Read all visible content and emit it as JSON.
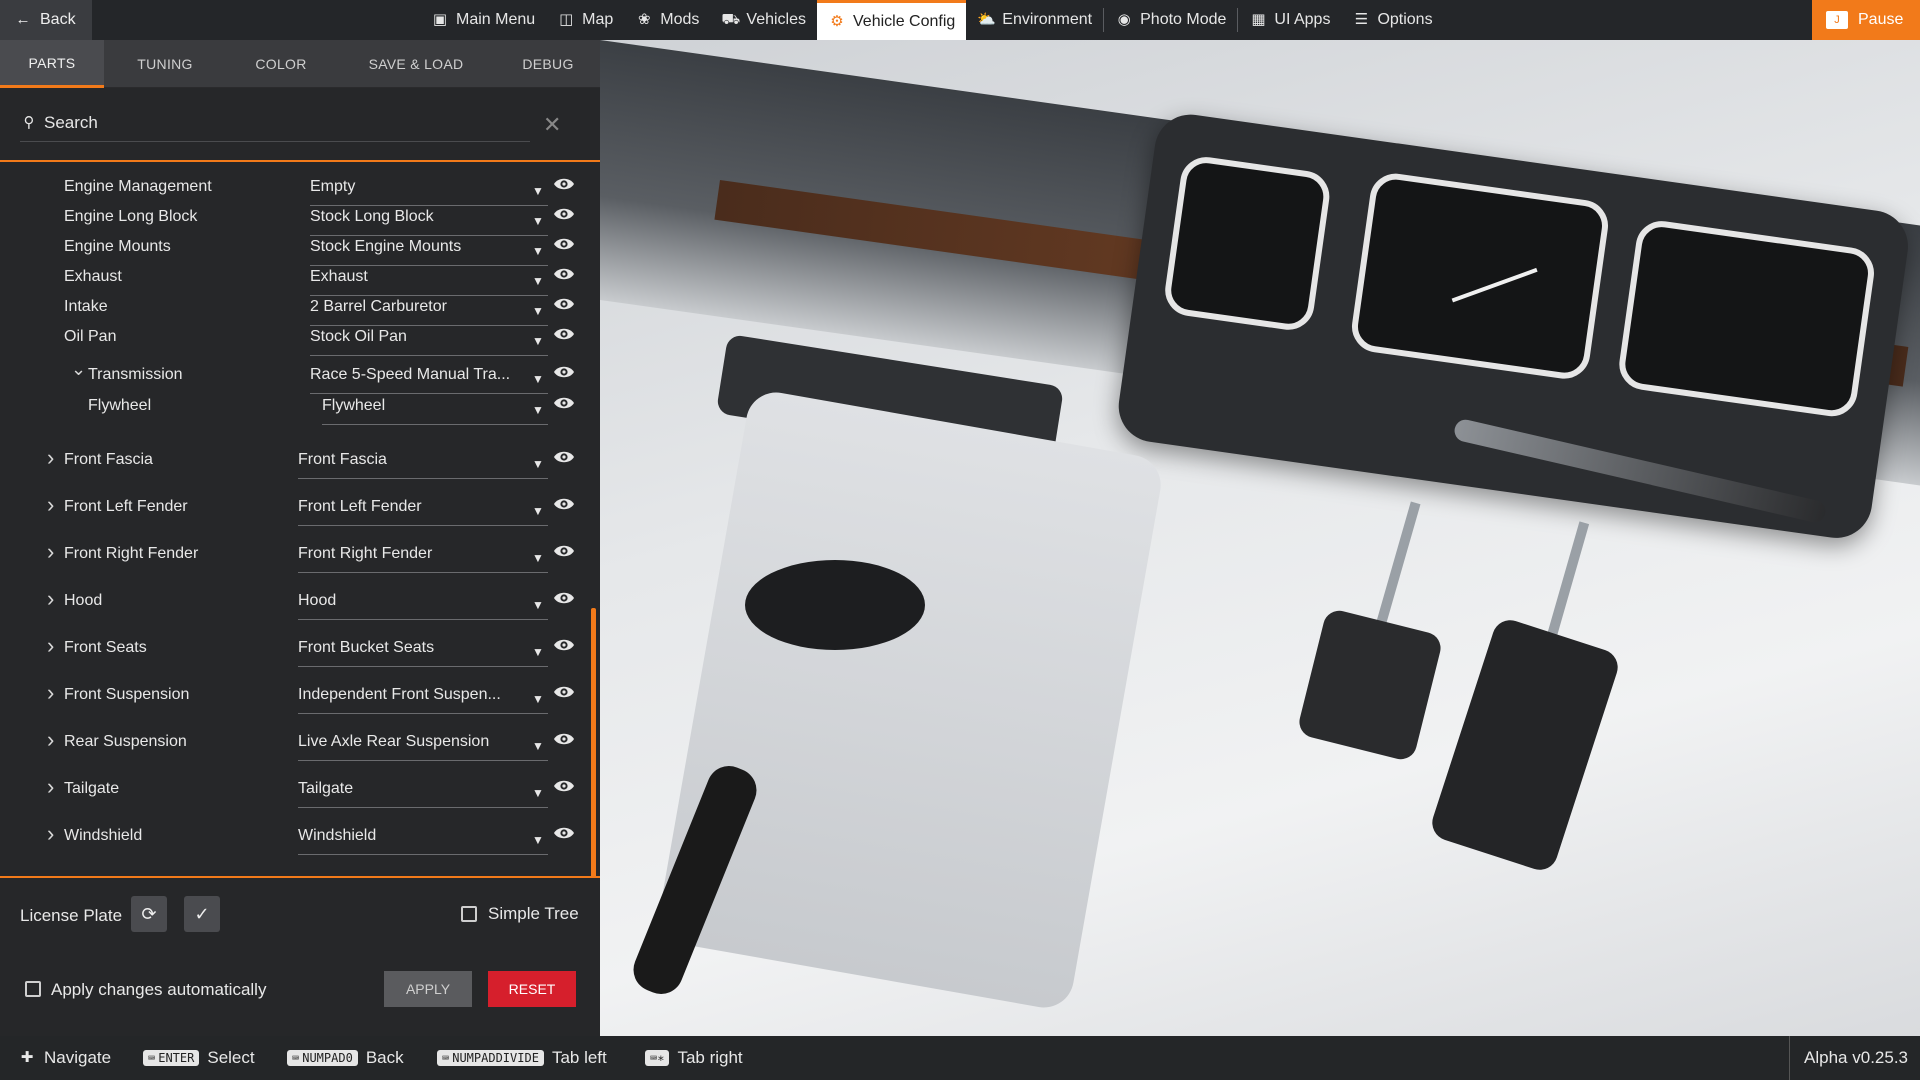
{
  "topbar": {
    "back_label": "Back",
    "nav": [
      {
        "label": "Main Menu",
        "icon": "home-icon"
      },
      {
        "label": "Map",
        "icon": "map-icon"
      },
      {
        "label": "Mods",
        "icon": "puzzle-icon"
      },
      {
        "label": "Vehicles",
        "icon": "car-icon"
      },
      {
        "label": "Vehicle Config",
        "icon": "engine-icon",
        "active": true
      },
      {
        "label": "Environment",
        "icon": "weather-icon"
      },
      {
        "label": "Photo Mode",
        "icon": "camera-icon"
      },
      {
        "label": "UI Apps",
        "icon": "apps-icon"
      },
      {
        "label": "Options",
        "icon": "sliders-icon"
      }
    ],
    "pause_label": "Pause"
  },
  "panel": {
    "tabs": [
      "PARTS",
      "TUNING",
      "COLOR",
      "SAVE & LOAD",
      "DEBUG"
    ],
    "active_tab": "PARTS",
    "search_placeholder": "Search",
    "parts": [
      {
        "label": "Engine Management",
        "value": "Empty"
      },
      {
        "label": "Engine Long Block",
        "value": "Stock Long Block"
      },
      {
        "label": "Engine Mounts",
        "value": "Stock Engine Mounts"
      },
      {
        "label": "Exhaust",
        "value": "Exhaust"
      },
      {
        "label": "Intake",
        "value": "2 Barrel Carburetor"
      },
      {
        "label": "Oil Pan",
        "value": "Stock Oil Pan"
      },
      {
        "label": "Transmission",
        "value": "Race 5-Speed Manual Tra..."
      },
      {
        "label": "Flywheel",
        "value": "Flywheel"
      },
      {
        "label": "Front Fascia",
        "value": "Front Fascia"
      },
      {
        "label": "Front Left Fender",
        "value": "Front Left Fender"
      },
      {
        "label": "Front Right Fender",
        "value": "Front Right Fender"
      },
      {
        "label": "Hood",
        "value": "Hood"
      },
      {
        "label": "Front Seats",
        "value": "Front Bucket Seats"
      },
      {
        "label": "Front Suspension",
        "value": "Independent Front Suspen..."
      },
      {
        "label": "Rear Suspension",
        "value": "Live Axle Rear Suspension"
      },
      {
        "label": "Tailgate",
        "value": "Tailgate"
      },
      {
        "label": "Windshield",
        "value": "Windshield"
      }
    ],
    "license_plate_label": "License Plate",
    "simple_tree_label": "Simple Tree",
    "apply_auto_label": "Apply changes automatically",
    "apply_label": "APPLY",
    "reset_label": "RESET"
  },
  "footer": {
    "navigate_label": "Navigate",
    "enter_key": "ENTER",
    "select_label": "Select",
    "numpad0_key": "NUMPAD0",
    "back_label": "Back",
    "numpaddivide_key": "NUMPADDIVIDE",
    "tab_left_label": "Tab left",
    "tab_right_label": "Tab right",
    "version": "Alpha v0.25.3"
  },
  "colors": {
    "accent": "#f27a1a",
    "reset": "#d61f2c"
  }
}
